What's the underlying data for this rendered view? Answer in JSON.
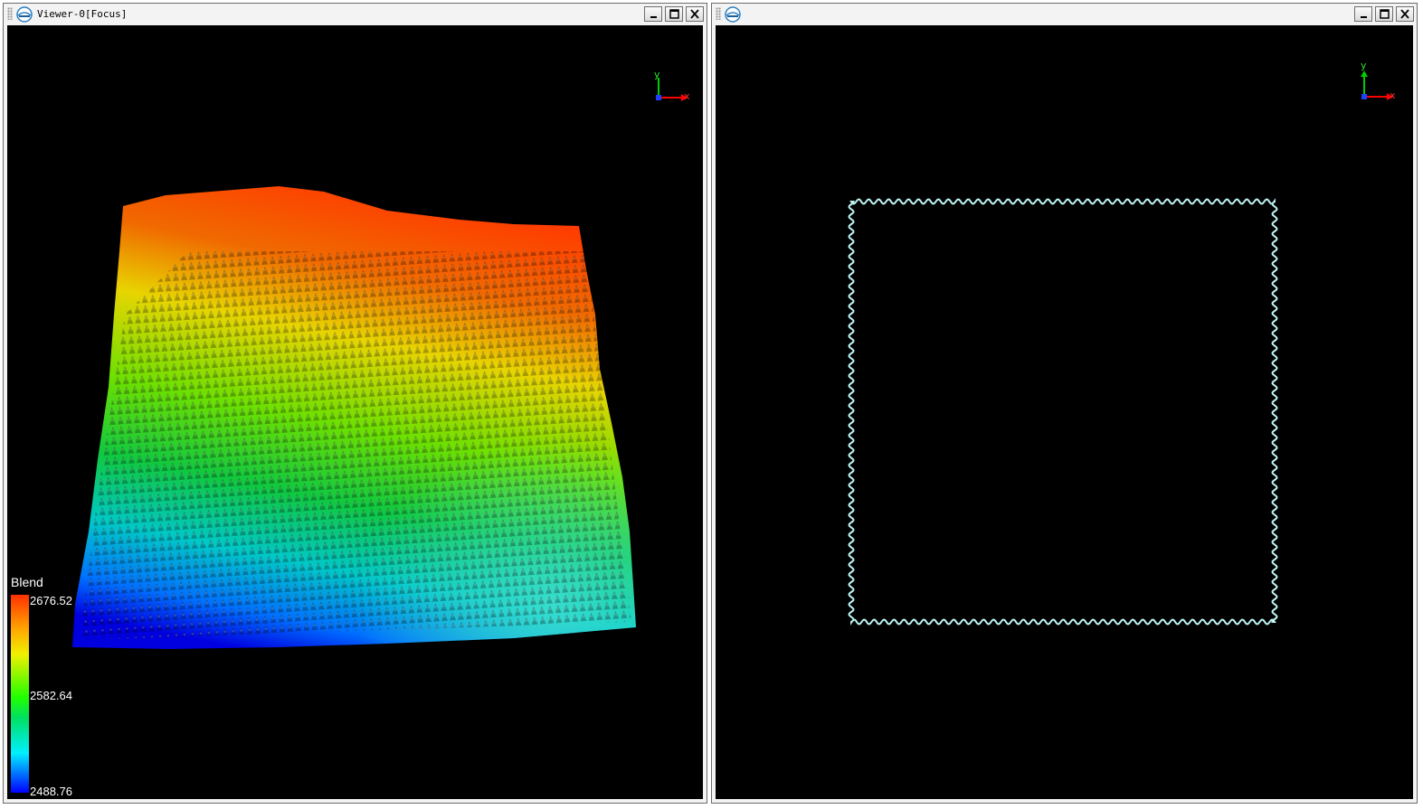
{
  "viewers": [
    {
      "title": "Viewer-0[Focus]",
      "buttons": {
        "minimize": "minimize",
        "maximize": "maximize",
        "close": "close"
      },
      "axes": {
        "x_label": "x",
        "y_label": "y"
      },
      "legend": {
        "title": "Blend",
        "max": "2676.52",
        "mid": "2582.64",
        "min": "2488.76",
        "colors": [
          "#ff3000",
          "#f0f000",
          "#20ff00",
          "#00f0ff",
          "#0000ff"
        ]
      }
    },
    {
      "title": "",
      "buttons": {
        "minimize": "minimize",
        "maximize": "maximize",
        "close": "close"
      },
      "axes": {
        "x_label": "x",
        "y_label": "y"
      },
      "boundary_color": "#bff4f4"
    }
  ]
}
